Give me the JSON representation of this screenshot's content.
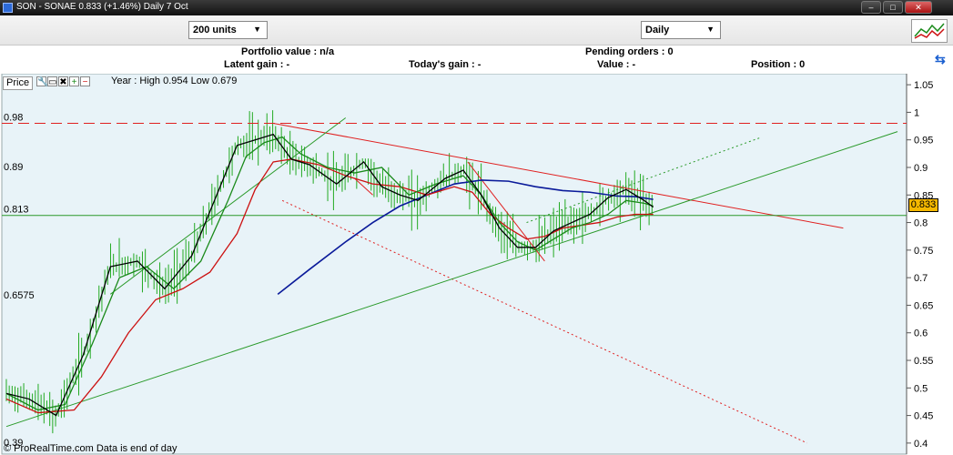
{
  "window": {
    "title": "SON - SONAE    0.833 (+1.46%)    Daily  7 Oct",
    "min_label": "–",
    "max_label": "□",
    "close_label": "✕"
  },
  "toolbar": {
    "units_select": "200 units",
    "timeframe_select": "Daily"
  },
  "infobar": {
    "portfolio_value": "Portfolio value : n/a",
    "pending_orders": "Pending orders : 0",
    "latent_gain": "Latent gain : -",
    "todays_gain": "Today's gain : -",
    "value": "Value : -",
    "position": "Position : 0"
  },
  "chart_header": {
    "legend_label": "Price",
    "year_info": "Year : High 0.954 Low 0.679"
  },
  "footer": "© ProRealTime.com Data is end of day",
  "colors": {
    "plot_bg": "#e8f3f8",
    "price_bars": "#22aa22",
    "ma_black": "#000000",
    "ma_green": "#1a8a1a",
    "ma_red": "#cc1111",
    "ma_blue": "#0a1a9a",
    "trend_red": "#e02020",
    "trend_green": "#2a9a2a",
    "price_tag": "#f5b800"
  },
  "chart_data": {
    "type": "line",
    "instrument": "SON - SONAE",
    "last_price": "0.833",
    "change": "+1.46%",
    "ylim": [
      0.38,
      1.07
    ],
    "right_ticks": [
      "1.05",
      "1",
      "0.95",
      "0.9",
      "0.85",
      "0.8",
      "0.75",
      "0.7",
      "0.65",
      "0.6",
      "0.55",
      "0.5",
      "0.45",
      "0.4"
    ],
    "left_labels": [
      {
        "text": "0.98",
        "value": 0.98
      },
      {
        "text": "0.89",
        "value": 0.89
      },
      {
        "text": "0.813",
        "value": 0.813
      },
      {
        "text": "0.6575",
        "value": 0.6575
      },
      {
        "text": "0.39",
        "value": 0.39
      }
    ],
    "horizontal_lines": [
      {
        "value": 0.98,
        "style": "dashed",
        "color": "red"
      },
      {
        "value": 0.813,
        "style": "solid",
        "color": "green"
      }
    ],
    "trendlines": [
      {
        "x": [
          0.3,
          0.93
        ],
        "y": [
          0.98,
          0.79
        ],
        "color": "red",
        "style": "solid"
      },
      {
        "x": [
          0.31,
          0.89
        ],
        "y": [
          0.84,
          0.4
        ],
        "color": "red",
        "style": "dotted"
      },
      {
        "x": [
          0.005,
          0.99
        ],
        "y": [
          0.43,
          0.965
        ],
        "color": "green",
        "style": "solid"
      },
      {
        "x": [
          0.12,
          0.38
        ],
        "y": [
          0.67,
          0.99
        ],
        "color": "green",
        "style": "solid"
      },
      {
        "x": [
          0.58,
          0.84
        ],
        "y": [
          0.8,
          0.955
        ],
        "color": "green",
        "style": "dotted"
      },
      {
        "x": [
          0.39,
          0.41
        ],
        "y": [
          0.88,
          0.85
        ],
        "color": "red",
        "style": "solid"
      },
      {
        "x": [
          0.515,
          0.6
        ],
        "y": [
          0.91,
          0.73
        ],
        "color": "red",
        "style": "solid"
      }
    ],
    "series": [
      {
        "color": "blue",
        "x": [
          0.305,
          0.34,
          0.38,
          0.41,
          0.44,
          0.47,
          0.5,
          0.53,
          0.56,
          0.59,
          0.62,
          0.65,
          0.68,
          0.7,
          0.72
        ],
        "y": [
          0.67,
          0.715,
          0.765,
          0.8,
          0.83,
          0.85,
          0.87,
          0.877,
          0.875,
          0.865,
          0.858,
          0.855,
          0.848,
          0.847,
          0.842
        ]
      },
      {
        "color": "red",
        "x": [
          0.005,
          0.04,
          0.08,
          0.11,
          0.14,
          0.17,
          0.2,
          0.23,
          0.26,
          0.28,
          0.3,
          0.32,
          0.35,
          0.38,
          0.41,
          0.44,
          0.47,
          0.5,
          0.52,
          0.54,
          0.56,
          0.58,
          0.6,
          0.62,
          0.64,
          0.66,
          0.68,
          0.7,
          0.72
        ],
        "y": [
          0.48,
          0.455,
          0.46,
          0.52,
          0.6,
          0.66,
          0.68,
          0.71,
          0.78,
          0.86,
          0.91,
          0.915,
          0.905,
          0.885,
          0.87,
          0.865,
          0.85,
          0.865,
          0.855,
          0.815,
          0.79,
          0.77,
          0.775,
          0.79,
          0.795,
          0.8,
          0.81,
          0.815,
          0.815
        ]
      },
      {
        "color": "green",
        "x": [
          0.005,
          0.04,
          0.07,
          0.1,
          0.13,
          0.16,
          0.19,
          0.22,
          0.25,
          0.27,
          0.29,
          0.31,
          0.33,
          0.36,
          0.39,
          0.42,
          0.45,
          0.48,
          0.51,
          0.53,
          0.55,
          0.57,
          0.59,
          0.61,
          0.63,
          0.65,
          0.67,
          0.69,
          0.71,
          0.72
        ],
        "y": [
          0.49,
          0.46,
          0.47,
          0.58,
          0.7,
          0.72,
          0.68,
          0.73,
          0.84,
          0.92,
          0.945,
          0.955,
          0.925,
          0.9,
          0.89,
          0.9,
          0.85,
          0.87,
          0.885,
          0.85,
          0.8,
          0.765,
          0.75,
          0.77,
          0.79,
          0.8,
          0.815,
          0.84,
          0.835,
          0.83
        ]
      },
      {
        "color": "black",
        "x": [
          0.005,
          0.03,
          0.06,
          0.09,
          0.12,
          0.15,
          0.18,
          0.21,
          0.24,
          0.26,
          0.28,
          0.3,
          0.32,
          0.34,
          0.37,
          0.4,
          0.42,
          0.44,
          0.46,
          0.49,
          0.51,
          0.53,
          0.55,
          0.57,
          0.59,
          0.61,
          0.63,
          0.65,
          0.67,
          0.69,
          0.71,
          0.72
        ],
        "y": [
          0.49,
          0.48,
          0.45,
          0.56,
          0.72,
          0.73,
          0.68,
          0.74,
          0.86,
          0.94,
          0.95,
          0.96,
          0.915,
          0.905,
          0.87,
          0.91,
          0.865,
          0.85,
          0.84,
          0.88,
          0.895,
          0.85,
          0.79,
          0.755,
          0.755,
          0.785,
          0.8,
          0.815,
          0.845,
          0.86,
          0.84,
          0.828
        ]
      }
    ]
  }
}
